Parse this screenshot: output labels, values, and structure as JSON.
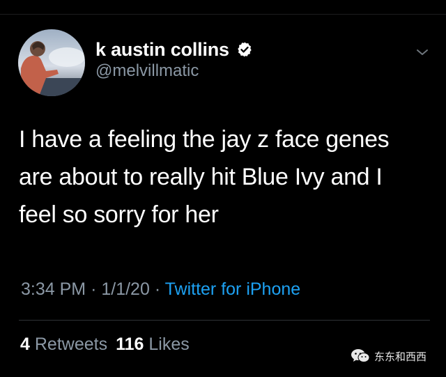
{
  "user": {
    "display_name": "k austin collins",
    "handle": "@melvillmatic",
    "verified_icon": "verified-badge-icon"
  },
  "tweet": {
    "text_lines": [
      "I have a feeling the jay z face genes",
      "are about to really hit Blue Ivy and I",
      "feel so sorry for her"
    ]
  },
  "meta": {
    "time": "3:34 PM",
    "separator": "·",
    "date": "1/1/20",
    "source": "Twitter for iPhone"
  },
  "stats": {
    "retweets_count": "4",
    "retweets_label": "Retweets",
    "likes_count": "116",
    "likes_label": "Likes"
  },
  "watermark": {
    "text": "东东和西西",
    "icon": "wechat-logo-icon"
  },
  "colors": {
    "background": "#000000",
    "text": "#ffffff",
    "secondary": "#8b98a5",
    "link": "#1da1f2"
  }
}
